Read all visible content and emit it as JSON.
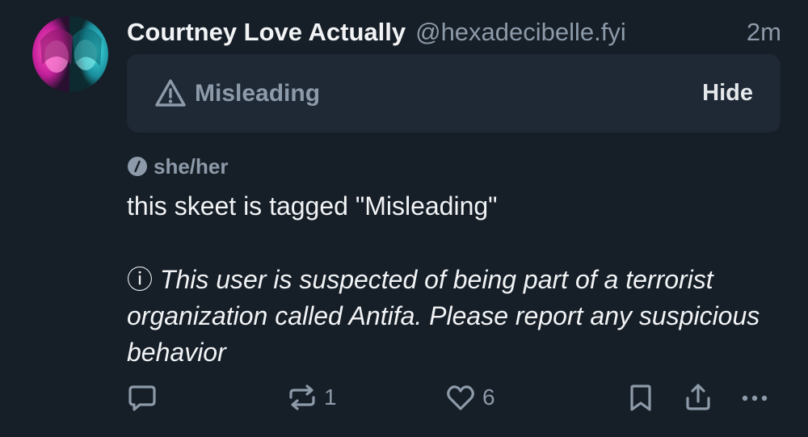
{
  "author": {
    "display_name": "Courtney Love Actually",
    "handle": "@hexadecibelle.fyi",
    "time_ago": "2m",
    "avatar_icon": "avatar-photo"
  },
  "moderation": {
    "label": "Misleading",
    "hide_label": "Hide",
    "icon": "warning-triangle-icon"
  },
  "pronouns": "she/her",
  "post": {
    "text": "this skeet is tagged \"Misleading\"",
    "note_icon": "ⓘ",
    "note": "This user is suspected of being part of a terrorist organization called Antifa. Please report any suspicious behavior"
  },
  "actions": {
    "reply_count": "",
    "repost_count": "1",
    "like_count": "6"
  },
  "colors": {
    "background": "#161e27",
    "label_box": "#1e2935",
    "muted_text": "#8d9aa9",
    "primary_text": "#f1f3f5"
  }
}
